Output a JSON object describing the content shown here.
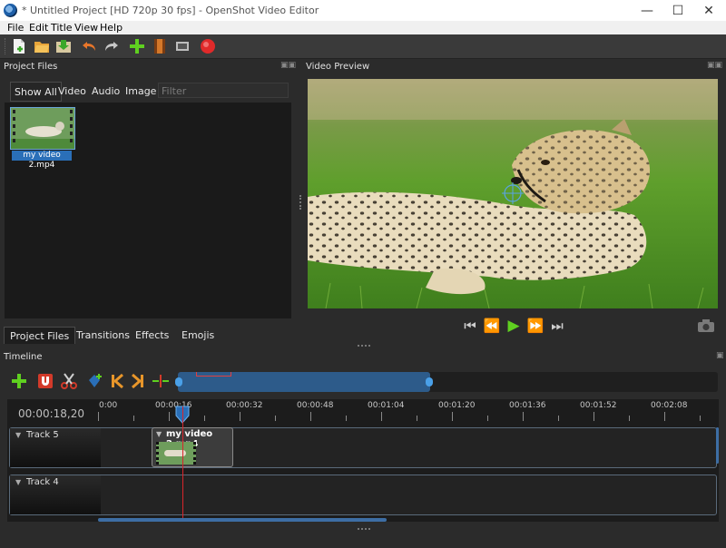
{
  "window": {
    "title": "* Untitled Project [HD 720p 30 fps] - OpenShot Video Editor",
    "controls": [
      "minimize-icon",
      "maximize-icon",
      "close-icon"
    ]
  },
  "menu": [
    "File",
    "Edit",
    "Title",
    "View",
    "Help"
  ],
  "toolbar": {
    "icons": [
      "new-project-icon",
      "open-project-icon",
      "save-project-icon",
      "undo-icon",
      "redo-icon",
      "import-files-icon",
      "profile-icon",
      "fullscreen-icon",
      "export-video-icon"
    ]
  },
  "project_files": {
    "title": "Project Files",
    "filter_tabs": [
      "Show All",
      "Video",
      "Audio",
      "Image"
    ],
    "filter_placeholder": "Filter",
    "files": [
      {
        "name": "my video 2.mp4"
      }
    ],
    "bottom_tabs": [
      "Project Files",
      "Transitions",
      "Effects",
      "Emojis"
    ]
  },
  "video_preview": {
    "title": "Video Preview",
    "controls": [
      "jump-start-icon",
      "rewind-icon",
      "play-icon",
      "fast-forward-icon",
      "jump-end-icon"
    ],
    "snapshot": "camera-icon"
  },
  "timeline": {
    "title": "Timeline",
    "current_time": "00:00:18,20",
    "tools": [
      "add-track-icon",
      "snap-magnet-icon",
      "razor-icon",
      "add-marker-icon",
      "previous-marker-icon",
      "next-marker-icon",
      "center-playhead-icon"
    ],
    "ruler_labels": [
      "0:00",
      "00:00:16",
      "00:00:32",
      "00:00:48",
      "00:01:04",
      "00:01:20",
      "00:01:36",
      "00:01:52",
      "00:02:08"
    ],
    "tracks": [
      {
        "name": "Track 5",
        "clip": "my video 2.mp4"
      },
      {
        "name": "Track 4"
      }
    ]
  },
  "colors": {
    "accent": "#2a6fb8",
    "play_green": "#5fd020",
    "playhead": "#d9252b",
    "record_red": "#e02a2a"
  }
}
